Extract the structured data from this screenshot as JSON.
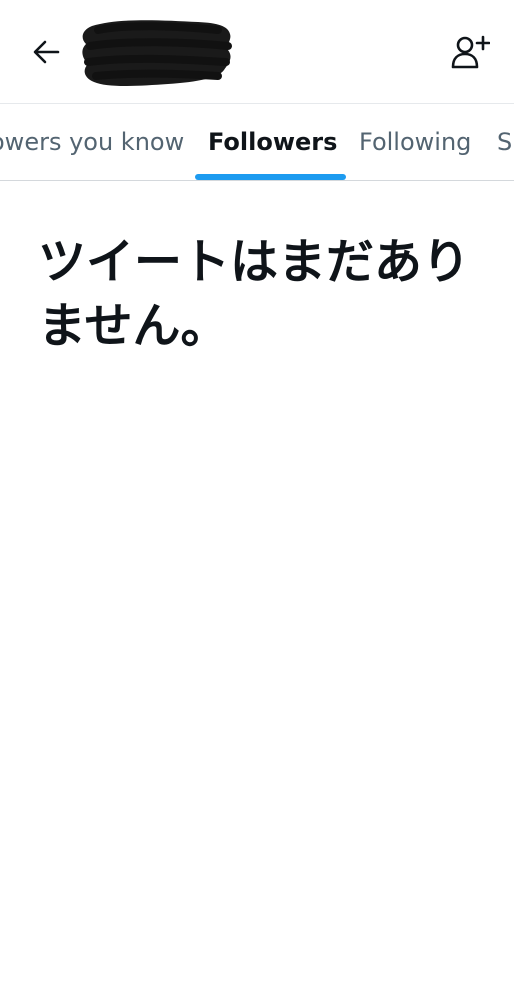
{
  "header": {
    "back_icon": "arrow-left-icon",
    "follow_icon": "person-add-icon",
    "name_redacted": true
  },
  "tabs": [
    {
      "label": "Followers you know",
      "visible_text": "owers you know",
      "active": false
    },
    {
      "label": "Followers",
      "active": true
    },
    {
      "label": "Following",
      "active": false
    },
    {
      "label": "Subscriptions",
      "visible_text": "S",
      "active": false
    }
  ],
  "accent_color": "#1d9bf0",
  "empty_state": {
    "title": "ツイートはまだありません。"
  }
}
